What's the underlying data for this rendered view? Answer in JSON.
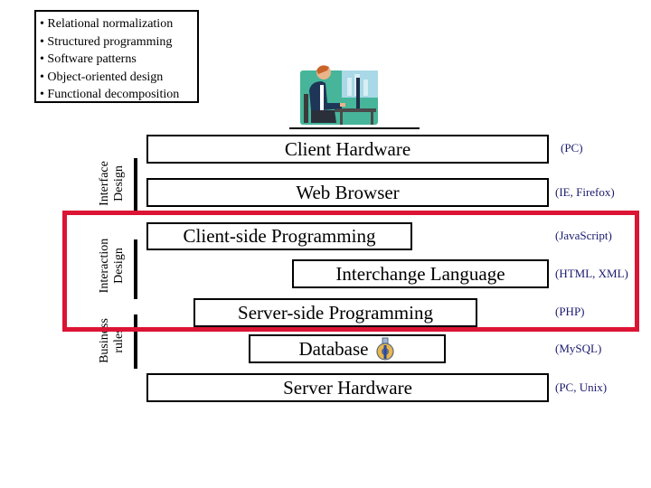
{
  "concepts": {
    "items": [
      "Relational normalization",
      "Structured programming",
      "Software patterns",
      "Object-oriented design",
      "Functional decomposition"
    ],
    "bullet": "•"
  },
  "illustration": {
    "icon": "person-at-computer-icon"
  },
  "layers": [
    {
      "label": "Client Hardware",
      "tech": "(PC)"
    },
    {
      "label": "Web Browser",
      "tech": "(IE, Firefox)"
    },
    {
      "label": "Client-side Programming",
      "tech": "(JavaScript)"
    },
    {
      "label": "Interchange Language",
      "tech": "(HTML, XML)"
    },
    {
      "label": "Server-side Programming",
      "tech": "(PHP)"
    },
    {
      "label": "Database",
      "tech": "(MySQL)",
      "icon": "database-flask-icon"
    },
    {
      "label": "Server Hardware",
      "tech": "(PC, Unix)"
    }
  ],
  "side_labels": [
    {
      "line1": "Interface",
      "line2": "Design"
    },
    {
      "line1": "Interaction",
      "line2": "Design"
    },
    {
      "line1": "Business",
      "line2": "rules"
    }
  ],
  "highlight": {
    "color": "#dc1434"
  }
}
